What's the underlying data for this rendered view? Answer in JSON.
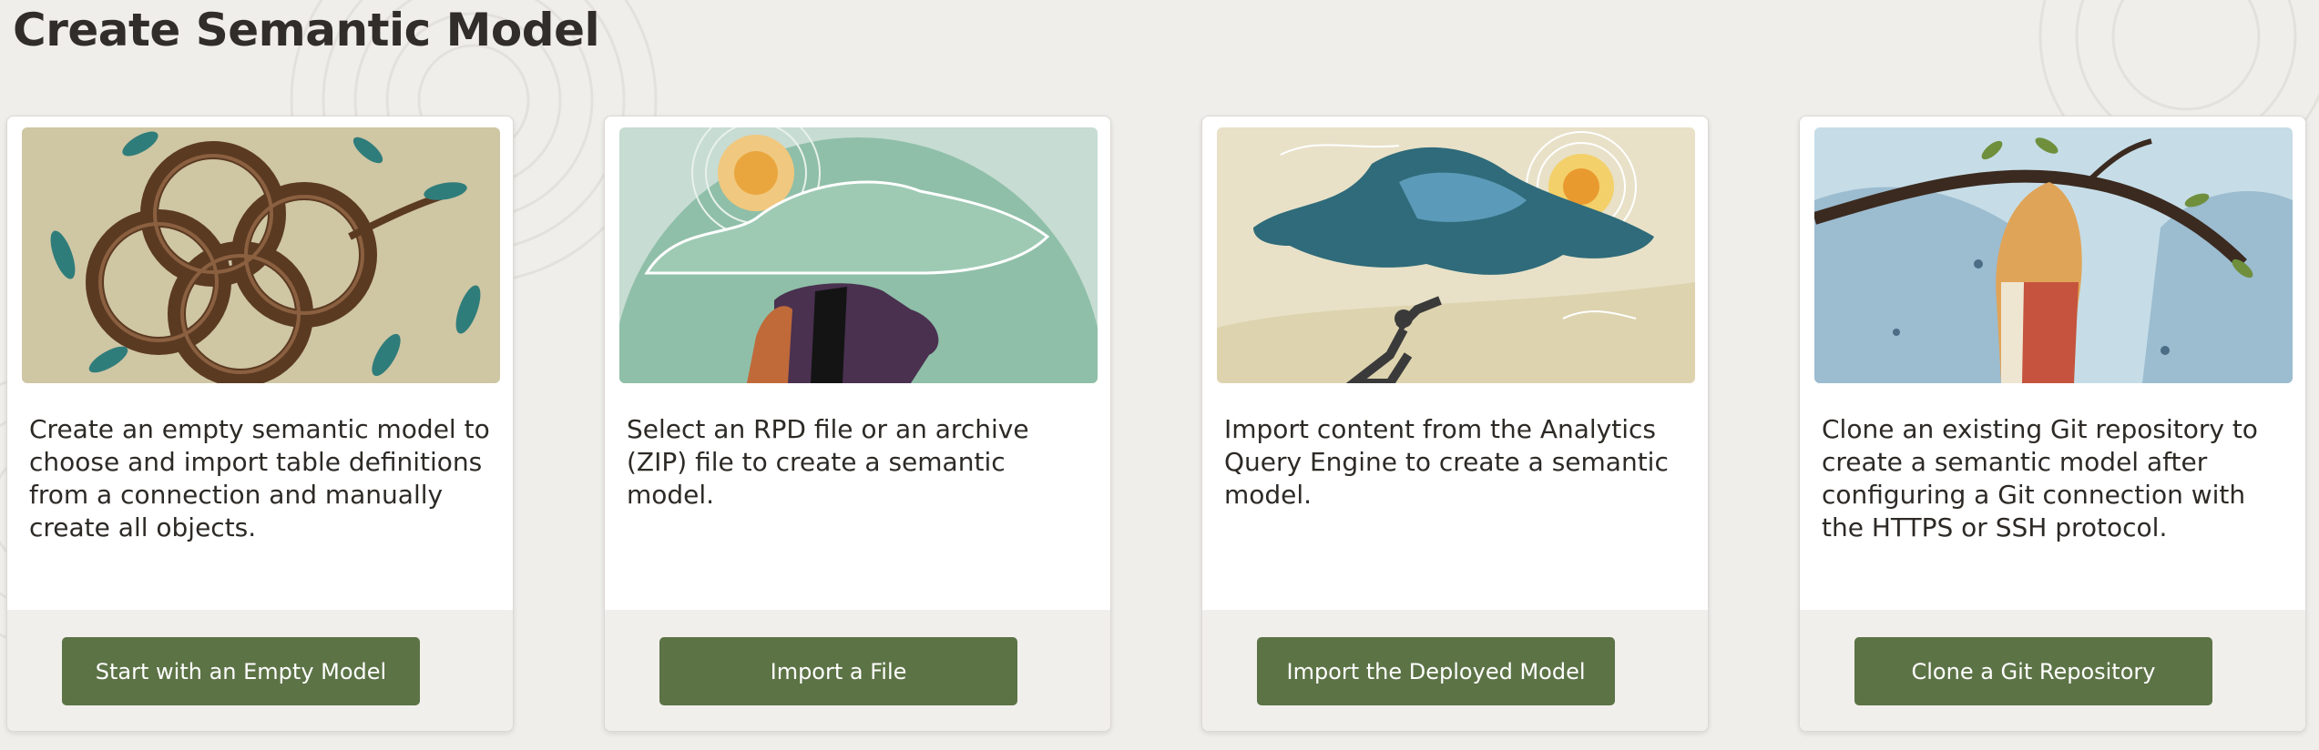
{
  "page": {
    "title": "Create Semantic Model"
  },
  "cards": [
    {
      "art": "interlocking-rings-illustration",
      "description": "Create an empty semantic model to choose and import table definitions from a connection and manually create all objects.",
      "button_label": "Start with an Empty Model"
    },
    {
      "art": "sun-cloud-head-illustration",
      "description": "Select an RPD file or an archive (ZIP) file to create a semantic model.",
      "button_label": "Import a File"
    },
    {
      "art": "reaching-person-cloud-illustration",
      "description": "Import content from the Analytics Query Engine to create a semantic model.",
      "button_label": "Import the Deployed Model"
    },
    {
      "art": "branch-hive-illustration",
      "description": "Clone an existing Git repository to create a semantic model after configuring a Git connection with the HTTPS or SSH protocol.",
      "button_label": "Clone a Git Repository"
    }
  ],
  "colors": {
    "background": "#efeeeb",
    "card": "#ffffff",
    "card_footer": "#f1efec",
    "button": "#5c7346",
    "button_text": "#ffffff",
    "text": "#2d2a26"
  }
}
